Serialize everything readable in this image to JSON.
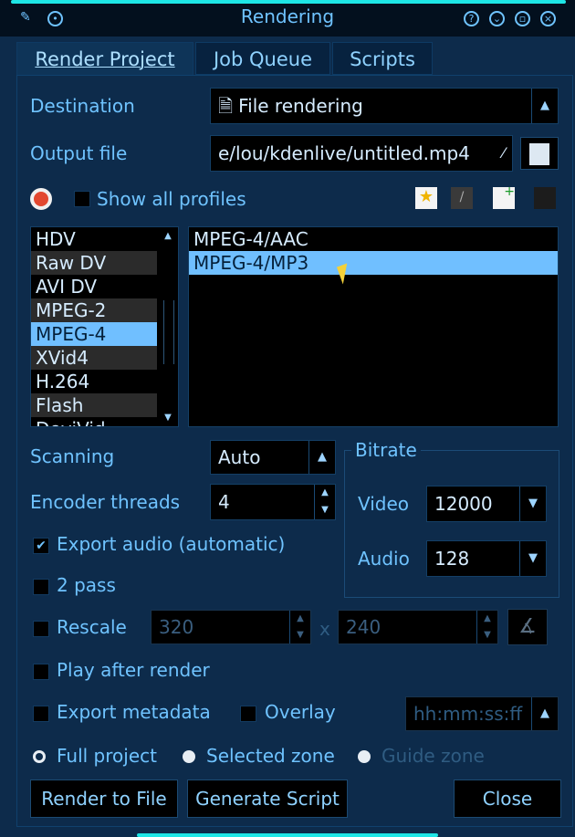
{
  "window": {
    "title": "Rendering"
  },
  "tabs": [
    {
      "label": "Render Project"
    },
    {
      "label": "Job Queue"
    },
    {
      "label": "Scripts"
    }
  ],
  "destination": {
    "label": "Destination",
    "value": "File rendering"
  },
  "output": {
    "label": "Output file",
    "value": "e/lou/kdenlive/untitled.mp4"
  },
  "profiles": {
    "show_all_label": "Show all profiles"
  },
  "formats": [
    "HDV",
    "Raw DV",
    "AVI DV",
    "MPEG-2",
    "MPEG-4",
    "XVid4",
    "H.264",
    "Flash",
    "DeviVid"
  ],
  "selected_format": "MPEG-4",
  "codecs": [
    "MPEG-4/AAC",
    "MPEG-4/MP3"
  ],
  "selected_codec": "MPEG-4/MP3",
  "scanning": {
    "label": "Scanning",
    "value": "Auto"
  },
  "threads": {
    "label": "Encoder threads",
    "value": "4"
  },
  "bitrate": {
    "title": "Bitrate",
    "video_label": "Video",
    "video_value": "12000",
    "audio_label": "Audio",
    "audio_value": "128"
  },
  "export_audio": {
    "label": "Export audio (automatic)"
  },
  "two_pass": {
    "label": "2 pass"
  },
  "rescale": {
    "label": "Rescale",
    "width": "320",
    "x": "x",
    "height": "240"
  },
  "play_after": {
    "label": "Play after render"
  },
  "metadata": {
    "label": "Export metadata"
  },
  "overlay": {
    "label": "Overlay",
    "value": "hh:mm:ss:ff"
  },
  "zones": {
    "full": "Full project",
    "selected": "Selected zone",
    "guide": "Guide zone"
  },
  "buttons": {
    "render": "Render to File",
    "script": "Generate Script",
    "close": "Close"
  },
  "colors": {
    "background": "#0d2b4b",
    "text": "#6fc3ff",
    "selection": "#70bfff",
    "title_accent": "#1ee6e6"
  }
}
